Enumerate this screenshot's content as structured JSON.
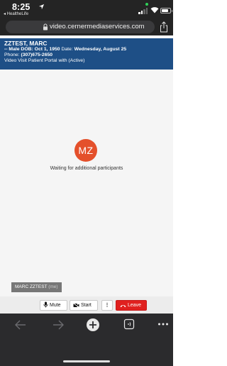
{
  "status_bar": {
    "time": "8:25",
    "back_app": "◂ HealtheLife"
  },
  "browser": {
    "url": "video.cernermediaservices.com"
  },
  "patient": {
    "name": "ZZTEST, MARC",
    "line1_prefix": "-- Male DOB: ",
    "dob": "Oct 1, 1950",
    "date_label": " Date: ",
    "date": "Wednesday, August 25",
    "phone_label": "Phone: ",
    "phone": "(307)675-2650",
    "visit": "Video Visit Patient Portal with (Active)"
  },
  "video": {
    "avatar_initials": "MZ",
    "waiting_text": "Waiting for additional participants",
    "participant_name": "MARC ZZTEST",
    "participant_tag": "(me)"
  },
  "toolbar": {
    "mute_label": "Mute",
    "start_label": "Start",
    "more_label": "⋮",
    "leave_label": "Leave"
  },
  "colors": {
    "banner": "#1e4f86",
    "avatar": "#e4502b",
    "leave": "#e0201f"
  },
  "icons": [
    "location-arrow-icon",
    "signal-icon",
    "wifi-icon",
    "battery-icon",
    "lock-icon",
    "share-icon",
    "microphone-icon",
    "camera-icon",
    "phone-hangup-icon",
    "back-arrow-icon",
    "forward-arrow-icon",
    "new-tab-icon",
    "tabs-icon",
    "more-icon"
  ]
}
